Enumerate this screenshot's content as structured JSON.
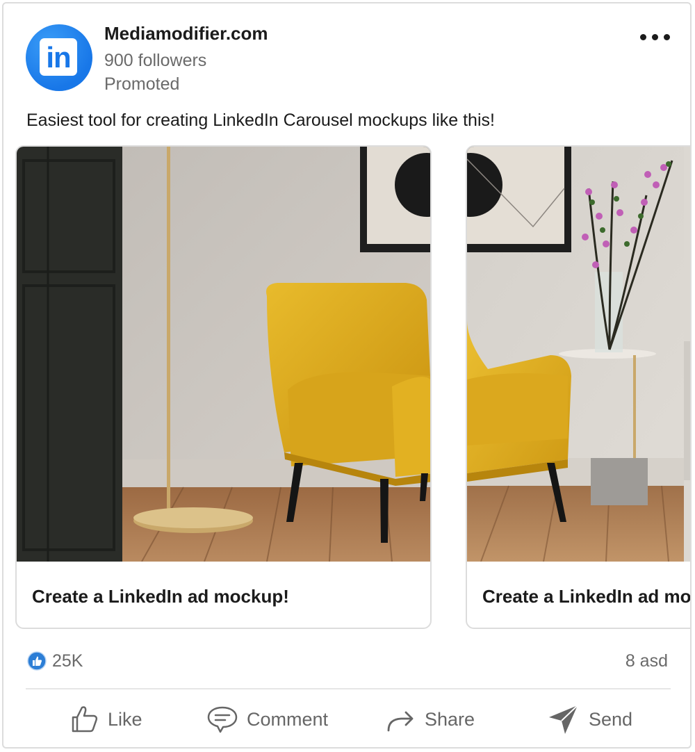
{
  "post": {
    "company_name": "Mediamodifier.com",
    "followers": "900 followers",
    "promoted": "Promoted",
    "avatar_text": "in",
    "caption": "Easiest tool for creating LinkedIn Carousel mockups like this!"
  },
  "carousel": {
    "cards": [
      {
        "title": "Create a LinkedIn ad mockup!"
      },
      {
        "title": "Create a LinkedIn ad mo"
      }
    ]
  },
  "stats": {
    "reaction_count": "25K",
    "meta_right": "8 asd"
  },
  "actions": [
    {
      "label": "Like",
      "icon": "like-icon"
    },
    {
      "label": "Comment",
      "icon": "comment-icon"
    },
    {
      "label": "Share",
      "icon": "share-icon"
    },
    {
      "label": "Send",
      "icon": "send-icon"
    }
  ],
  "colors": {
    "brand_blue": "#1877e8",
    "chair_yellow": "#e3b122",
    "text_primary": "#1b1b1b",
    "text_secondary": "#6a6a6a"
  }
}
